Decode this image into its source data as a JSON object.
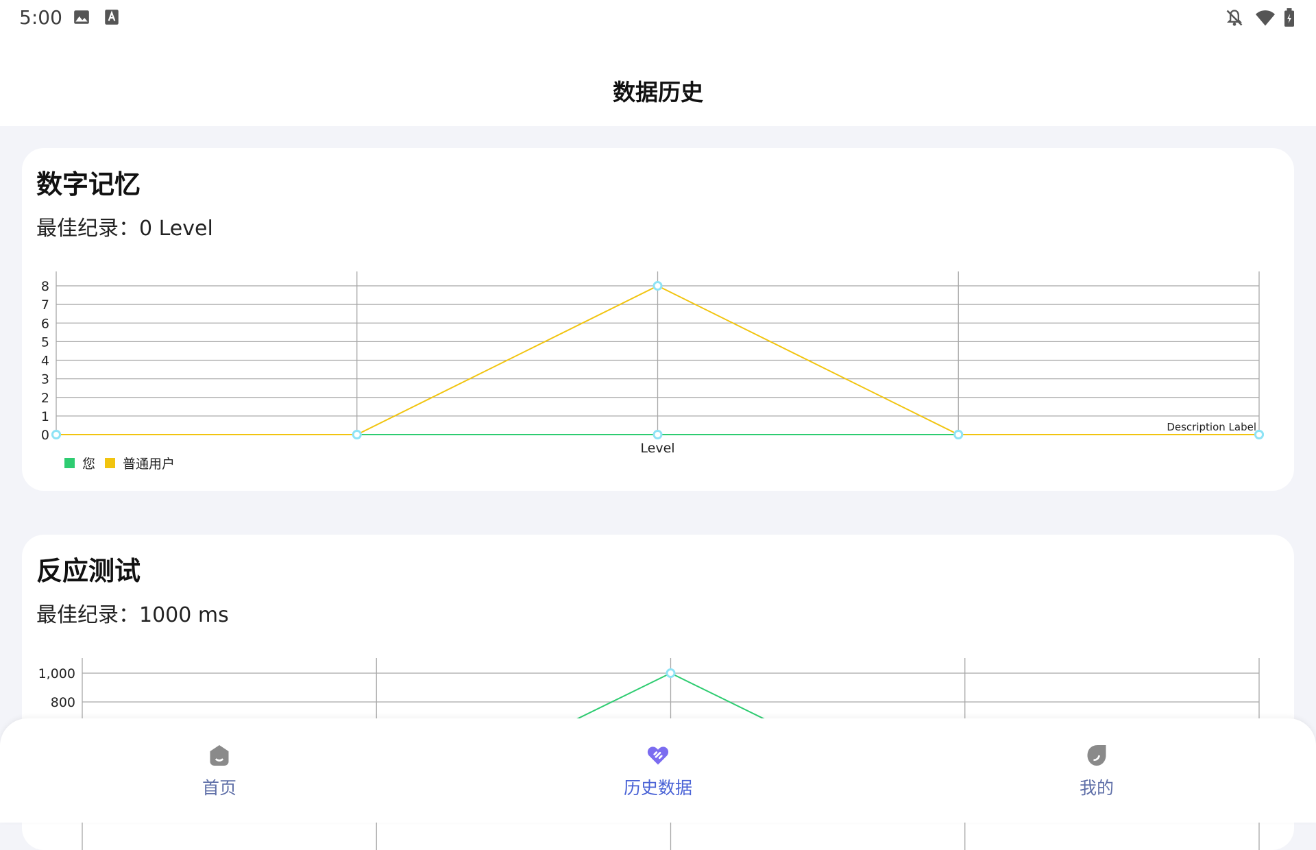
{
  "status_bar": {
    "time": "5:00",
    "icons": [
      "image-icon",
      "text-a-icon",
      "bell-off-icon",
      "wifi-icon",
      "battery-icon"
    ]
  },
  "header": {
    "title": "数据历史"
  },
  "cards": [
    {
      "title": "数字记忆",
      "best_record": "最佳纪录：0 Level"
    },
    {
      "title": "反应测试",
      "best_record": "最佳纪录：1000 ms"
    }
  ],
  "chart_data": [
    {
      "type": "line",
      "xlabel": "Level",
      "description": "Description Label",
      "x_points": 5,
      "ylim": [
        0,
        8
      ],
      "y_ticks": [
        "0",
        "1",
        "2",
        "3",
        "4",
        "5",
        "6",
        "7",
        "8"
      ],
      "series": [
        {
          "name": "您",
          "color": "#2ecc71",
          "values": [
            0,
            0,
            0,
            0,
            0
          ]
        },
        {
          "name": "普通用户",
          "color": "#f1c40f",
          "values": [
            0,
            0,
            8,
            0,
            0
          ]
        }
      ]
    },
    {
      "type": "line",
      "x_points": 5,
      "y_ticks": [
        "1,000",
        "800"
      ],
      "series": [
        {
          "name": "您",
          "color": "#2ecc71",
          "values": [
            0,
            0,
            1000,
            0,
            0
          ]
        }
      ]
    }
  ],
  "nav": {
    "items": [
      {
        "label": "首页",
        "icon": "home-icon",
        "active": false
      },
      {
        "label": "历史数据",
        "icon": "heart-link-icon",
        "active": true
      },
      {
        "label": "我的",
        "icon": "profile-leaf-icon",
        "active": false
      }
    ],
    "active_color": "#4a63d6",
    "inactive_color": "#5f6fa8"
  }
}
